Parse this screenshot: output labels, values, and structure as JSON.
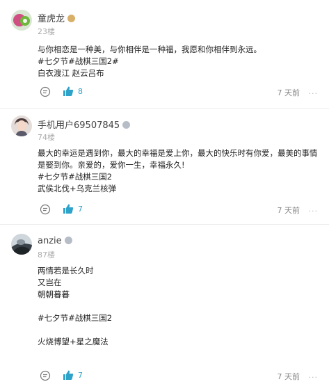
{
  "accent_color": "#2ea2c8",
  "posts": [
    {
      "username": "童虎龙",
      "badge_icon": "gold-medal-icon",
      "floor": "23楼",
      "content": [
        "与你相恋是一种美，与你相伴是一种福，我愿和你相伴到永远。",
        "#七夕节#战棋三国2#",
        "白衣渡江  赵云吕布"
      ],
      "likes": "8",
      "time": "7 天前",
      "more": "..."
    },
    {
      "username": "手机用户69507845",
      "badge_icon": "gray-medal-icon",
      "floor": "74楼",
      "content": [
        "最大的幸运是遇到你，最大的幸福是爱上你，最大的快乐时有你爱，最美的事情是娶到你。亲爱的，爱你一生，幸福永久!",
        "#七夕节#战棋三国2",
        "武侯北伐+乌克兰核弹"
      ],
      "likes": "7",
      "time": "7 天前",
      "more": "..."
    },
    {
      "username": "anzie",
      "badge_icon": "gray-medal-icon",
      "floor": "87楼",
      "content": [
        "两情若是长久时",
        "又岂在",
        "朝朝暮暮",
        "",
        "#七夕节#战棋三国2",
        "",
        "火烧博望+星之魔法"
      ],
      "likes": "7",
      "time": "7 天前",
      "more": "..."
    }
  ]
}
